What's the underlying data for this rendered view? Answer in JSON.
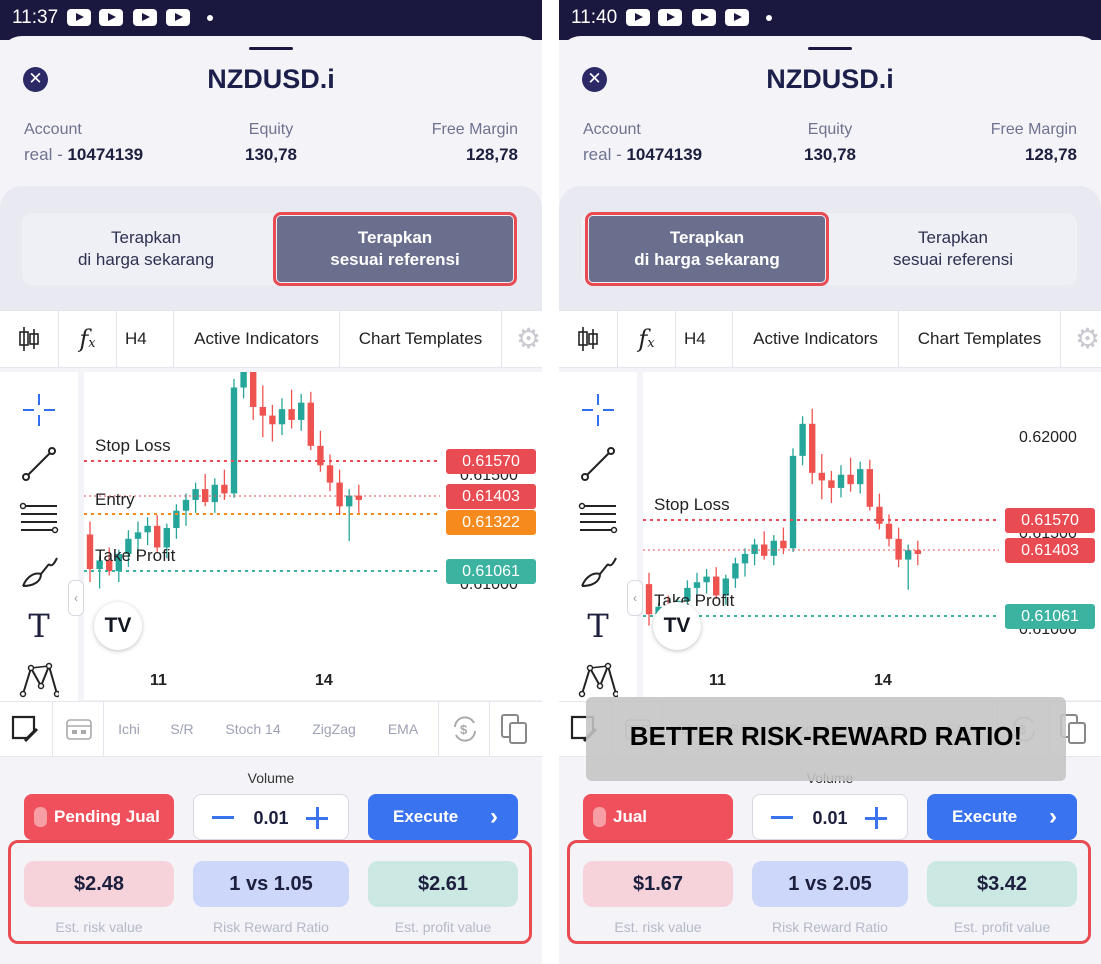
{
  "colors": {
    "status_bar": "#1b1840",
    "sell": "#f0505c",
    "execute": "#3a73f0",
    "stop_loss": "#e94b52",
    "entry": "#e94b52",
    "pending": "#f78a1d",
    "take_profit": "#3bb3a0",
    "bull": "#26a69a",
    "bear": "#ef5350",
    "highlight": "#e94b52",
    "selected_mode": "#6a6f8e",
    "risk_pill": "#f6d3da",
    "ratio_pill": "#cdd7fa",
    "profit_pill": "#cbe8e2"
  },
  "common": {
    "symbol": "NZDUSD.i",
    "account_label": "Account",
    "account_prefix": "real -",
    "account_number": "10474139",
    "equity_label": "Equity",
    "equity_value": "130,78",
    "margin_label": "Free Margin",
    "margin_value": "128,78",
    "mode_current": [
      "Terapkan",
      "di harga sekarang"
    ],
    "mode_reference": [
      "Terapkan",
      "sesuai referensi"
    ],
    "timeframe": "H4",
    "active_indicators": "Active Indicators",
    "chart_templates": "Chart Templates",
    "x_ticks": [
      "11",
      "14"
    ],
    "indicators": [
      "Ichi",
      "S/R",
      "Stoch 14",
      "ZigZag",
      "EMA"
    ],
    "volume_label": "Volume",
    "volume_value": "0.01",
    "execute_label": "Execute",
    "risk_caption": "Est. risk value",
    "ratio_caption": "Risk Reward Ratio",
    "profit_caption": "Est. profit value",
    "stop_loss_label": "Stop Loss",
    "take_profit_label": "Take Profit",
    "entry_label": "Entry",
    "icons": [
      "close-icon",
      "candlestick-icon",
      "function-icon",
      "gear-icon",
      "crosshair-icon",
      "trendline-icon",
      "fib-lines-icon",
      "brush-icon",
      "text-icon",
      "pattern-icon",
      "note-icon",
      "calendar-icon",
      "currency-exchange-icon",
      "copy-icon",
      "chevron-right-icon",
      "lock-icon"
    ]
  },
  "screens": [
    {
      "time": "11:37",
      "selected_mode": "reference",
      "sell_label": "Pending Jual",
      "risk_value": "$2.48",
      "ratio_value": "1 vs 1.05",
      "profit_value": "$2.61",
      "price_tags": {
        "sl": "0.61570",
        "entry": "0.61403",
        "pending": "0.61322",
        "tp": "0.61061"
      },
      "axis_prices": [
        "0.61500",
        "0.61000"
      ]
    },
    {
      "time": "11:40",
      "selected_mode": "current",
      "sell_label": "Jual",
      "risk_value": "$1.67",
      "ratio_value": "1 vs 2.05",
      "profit_value": "$3.42",
      "price_tags": {
        "sl": "0.61570",
        "entry": "0.61403",
        "tp": "0.61061"
      },
      "axis_prices": [
        "0.62000",
        "0.61500",
        "0.61000"
      ],
      "banner": "BETTER RISK-REWARD RATIO!"
    }
  ],
  "chart_data": [
    {
      "type": "candlestick",
      "symbol": "NZDUSD.i",
      "timeframe": "H4",
      "x_ticks": [
        "11",
        "14"
      ],
      "levels": {
        "stop_loss": 0.6157,
        "entry": 0.61403,
        "pending_entry": 0.61322,
        "take_profit": 0.61061
      },
      "candles": [
        [
          0.6123,
          0.6129,
          0.6101,
          0.6107
        ],
        [
          0.6107,
          0.6113,
          0.6098,
          0.6111
        ],
        [
          0.6111,
          0.6117,
          0.6104,
          0.6106
        ],
        [
          0.6106,
          0.6116,
          0.6101,
          0.6114
        ],
        [
          0.6114,
          0.6125,
          0.6108,
          0.6121
        ],
        [
          0.6121,
          0.6129,
          0.6113,
          0.6124
        ],
        [
          0.6124,
          0.6131,
          0.6118,
          0.6127
        ],
        [
          0.6127,
          0.6132,
          0.6115,
          0.6117
        ],
        [
          0.6117,
          0.6128,
          0.6112,
          0.6126
        ],
        [
          0.6126,
          0.6137,
          0.6121,
          0.6134
        ],
        [
          0.6134,
          0.6142,
          0.6127,
          0.6139
        ],
        [
          0.6139,
          0.6147,
          0.6133,
          0.6144
        ],
        [
          0.6144,
          0.6151,
          0.6136,
          0.6138
        ],
        [
          0.6138,
          0.6149,
          0.6133,
          0.6146
        ],
        [
          0.6146,
          0.6153,
          0.6139,
          0.6142
        ],
        [
          0.6142,
          0.6195,
          0.614,
          0.6191
        ],
        [
          0.6191,
          0.6212,
          0.6186,
          0.6208
        ],
        [
          0.6208,
          0.6216,
          0.6176,
          0.6182
        ],
        [
          0.6182,
          0.6192,
          0.6168,
          0.6178
        ],
        [
          0.6178,
          0.6183,
          0.6166,
          0.6174
        ],
        [
          0.6174,
          0.6186,
          0.6169,
          0.6181
        ],
        [
          0.6181,
          0.619,
          0.6172,
          0.6176
        ],
        [
          0.6176,
          0.6188,
          0.6171,
          0.6184
        ],
        [
          0.6184,
          0.6189,
          0.6162,
          0.6164
        ],
        [
          0.6164,
          0.6171,
          0.6152,
          0.6155
        ],
        [
          0.6155,
          0.616,
          0.6143,
          0.6147
        ],
        [
          0.6147,
          0.6153,
          0.6132,
          0.6136
        ],
        [
          0.6136,
          0.6144,
          0.612,
          0.6141
        ],
        [
          0.6141,
          0.6146,
          0.6133,
          0.6139
        ]
      ]
    },
    {
      "type": "candlestick",
      "symbol": "NZDUSD.i",
      "timeframe": "H4",
      "x_ticks": [
        "11",
        "14"
      ],
      "levels": {
        "stop_loss": 0.6157,
        "entry": 0.61403,
        "take_profit": 0.61061
      },
      "candles": [
        [
          0.6123,
          0.6129,
          0.6101,
          0.6107
        ],
        [
          0.6107,
          0.6113,
          0.6098,
          0.6111
        ],
        [
          0.6111,
          0.6117,
          0.6104,
          0.6106
        ],
        [
          0.6106,
          0.6116,
          0.6101,
          0.6114
        ],
        [
          0.6114,
          0.6125,
          0.6108,
          0.6121
        ],
        [
          0.6121,
          0.6129,
          0.6113,
          0.6124
        ],
        [
          0.6124,
          0.6131,
          0.6118,
          0.6127
        ],
        [
          0.6127,
          0.6132,
          0.6115,
          0.6117
        ],
        [
          0.6117,
          0.6128,
          0.6112,
          0.6126
        ],
        [
          0.6126,
          0.6137,
          0.6121,
          0.6134
        ],
        [
          0.6134,
          0.6142,
          0.6127,
          0.6139
        ],
        [
          0.6139,
          0.6147,
          0.6133,
          0.6144
        ],
        [
          0.6144,
          0.6151,
          0.6136,
          0.6138
        ],
        [
          0.6138,
          0.6149,
          0.6133,
          0.6146
        ],
        [
          0.6146,
          0.6153,
          0.6139,
          0.6142
        ],
        [
          0.6142,
          0.6195,
          0.614,
          0.6191
        ],
        [
          0.6191,
          0.6212,
          0.6186,
          0.6208
        ],
        [
          0.6208,
          0.6216,
          0.6176,
          0.6182
        ],
        [
          0.6182,
          0.6192,
          0.6168,
          0.6178
        ],
        [
          0.6178,
          0.6183,
          0.6166,
          0.6174
        ],
        [
          0.6174,
          0.6186,
          0.6169,
          0.6181
        ],
        [
          0.6181,
          0.619,
          0.6172,
          0.6176
        ],
        [
          0.6176,
          0.6188,
          0.6171,
          0.6184
        ],
        [
          0.6184,
          0.6189,
          0.6162,
          0.6164
        ],
        [
          0.6164,
          0.6171,
          0.6152,
          0.6155
        ],
        [
          0.6155,
          0.616,
          0.6143,
          0.6147
        ],
        [
          0.6147,
          0.6153,
          0.6132,
          0.6136
        ],
        [
          0.6136,
          0.6144,
          0.612,
          0.6141
        ],
        [
          0.6141,
          0.6146,
          0.6133,
          0.6139
        ]
      ]
    }
  ]
}
